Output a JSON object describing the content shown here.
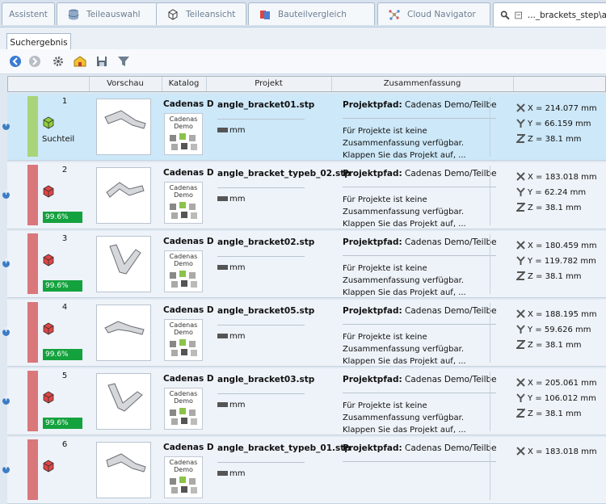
{
  "tabs": [
    {
      "label": "Assistent",
      "icon": "none"
    },
    {
      "label": "Teileauswahl",
      "icon": "database-icon"
    },
    {
      "label": "Teileansicht",
      "icon": "part-view-icon"
    },
    {
      "label": "Bauteilvergleich",
      "icon": "compare-icon"
    },
    {
      "label": "Cloud Navigator",
      "icon": "cloud-navigator-icon"
    },
    {
      "label": "..._brackets_step\\a",
      "icon": "search-result-icon"
    }
  ],
  "subtab": {
    "label": "Suchergebnis"
  },
  "toolbar": {
    "buttons": [
      "back-icon",
      "forward-icon",
      "settings-gear-icon",
      "home-folder-icon",
      "save-icon",
      "filter-icon"
    ]
  },
  "columns": {
    "preview": "Vorschau",
    "catalog": "Katalog",
    "project": "Projekt",
    "summary": "Zusammenfassung"
  },
  "results": [
    {
      "rank": "1",
      "label": "Suchteil",
      "match": "",
      "catalog": "Cadenas D",
      "catalog_logo": "Cadenas Demo",
      "project": "angle_bracket01.stp",
      "unit": "mm",
      "path_label": "Projektpfad:",
      "path_value": " Cadenas Demo/Teilbereich...",
      "summary": "Für Projekte ist keine Zusammenfassung verfügbar. Klappen Sie das Projekt auf, ...",
      "x": "X = 214.077 mm",
      "y": "Y = 66.159 mm",
      "z": "Z = 38.1 mm",
      "selected": true
    },
    {
      "rank": "2",
      "label": "",
      "match": "99.6%",
      "catalog": "Cadenas D",
      "catalog_logo": "Cadenas Demo",
      "project": "angle_bracket_typeb_02.stp",
      "unit": "mm",
      "path_label": "Projektpfad:",
      "path_value": " Cadenas Demo/Teilbereich...",
      "summary": "Für Projekte ist keine Zusammenfassung verfügbar. Klappen Sie das Projekt auf, ...",
      "x": "X = 183.018 mm",
      "y": "Y = 62.24 mm",
      "z": "Z = 38.1 mm",
      "selected": false
    },
    {
      "rank": "3",
      "label": "",
      "match": "99.6%",
      "catalog": "Cadenas D",
      "catalog_logo": "Cadenas Demo",
      "project": "angle_bracket02.stp",
      "unit": "mm",
      "path_label": "Projektpfad:",
      "path_value": " Cadenas Demo/Teilbereich...",
      "summary": "Für Projekte ist keine Zusammenfassung verfügbar. Klappen Sie das Projekt auf, ...",
      "x": "X = 180.459 mm",
      "y": "Y = 119.782 mm",
      "z": "Z = 38.1 mm",
      "selected": false
    },
    {
      "rank": "4",
      "label": "",
      "match": "99.6%",
      "catalog": "Cadenas D",
      "catalog_logo": "Cadenas Demo",
      "project": "angle_bracket05.stp",
      "unit": "mm",
      "path_label": "Projektpfad:",
      "path_value": " Cadenas Demo/Teilbereich...",
      "summary": "Für Projekte ist keine Zusammenfassung verfügbar. Klappen Sie das Projekt auf, ...",
      "x": "X = 188.195 mm",
      "y": "Y = 59.626 mm",
      "z": "Z = 38.1 mm",
      "selected": false
    },
    {
      "rank": "5",
      "label": "",
      "match": "99.6%",
      "catalog": "Cadenas D",
      "catalog_logo": "Cadenas Demo",
      "project": "angle_bracket03.stp",
      "unit": "mm",
      "path_label": "Projektpfad:",
      "path_value": " Cadenas Demo/Teilbereich...",
      "summary": "Für Projekte ist keine Zusammenfassung verfügbar. Klappen Sie das Projekt auf, ...",
      "x": "X = 205.061 mm",
      "y": "Y = 106.012 mm",
      "z": "Z = 38.1 mm",
      "selected": false
    },
    {
      "rank": "6",
      "label": "",
      "match": "",
      "catalog": "Cadenas D",
      "catalog_logo": "Cadenas Demo",
      "project": "angle_bracket_typeb_01.stp",
      "unit": "mm",
      "path_label": "Projektpfad:",
      "path_value": " Cadenas Demo/Teilbereich...",
      "summary": "",
      "x": "X = 183.018 mm",
      "y": "",
      "z": "",
      "selected": false
    }
  ],
  "colors": {
    "query_bar": "#a9d47a",
    "result_bar": "#d9777b",
    "match_badge": "#14a23e",
    "selected_row": "#cde8f8"
  }
}
